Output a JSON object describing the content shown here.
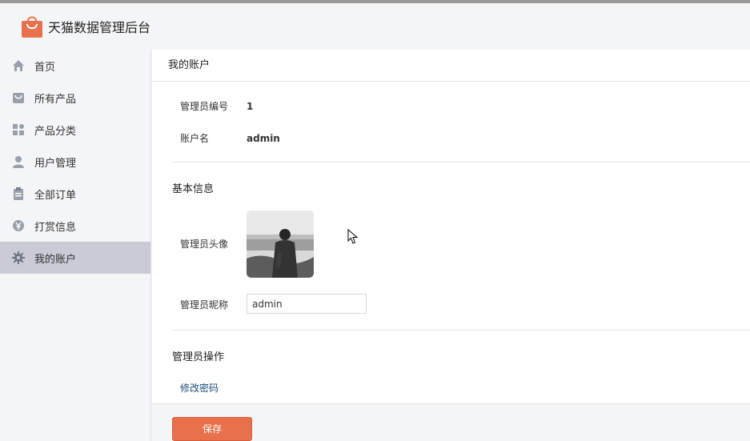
{
  "header": {
    "app_title": "天猫数据管理后台",
    "logo_icon": "shopping-bag-icon"
  },
  "sidebar": {
    "items": [
      {
        "label": "首页",
        "icon": "home-icon"
      },
      {
        "label": "所有产品",
        "icon": "bag-icon"
      },
      {
        "label": "产品分类",
        "icon": "category-grid-icon"
      },
      {
        "label": "用户管理",
        "icon": "user-icon"
      },
      {
        "label": "全部订单",
        "icon": "clipboard-icon"
      },
      {
        "label": "打赏信息",
        "icon": "yen-coin-icon"
      },
      {
        "label": "我的账户",
        "icon": "gear-icon",
        "active": true
      }
    ]
  },
  "main": {
    "panel_title": "我的账户",
    "admin_id_label": "管理员编号",
    "admin_id_value": "1",
    "account_name_label": "账户名",
    "account_name_value": "admin",
    "basic_info_title": "基本信息",
    "avatar_label": "管理员头像",
    "nickname_label": "管理员昵称",
    "nickname_value": "admin",
    "operations_title": "管理员操作",
    "change_password_link": "修改密码"
  },
  "footer": {
    "save_label": "保存"
  },
  "colors": {
    "accent": "#e8704a",
    "active_nav": "#c9ccd6",
    "link": "#1a4f7a"
  }
}
